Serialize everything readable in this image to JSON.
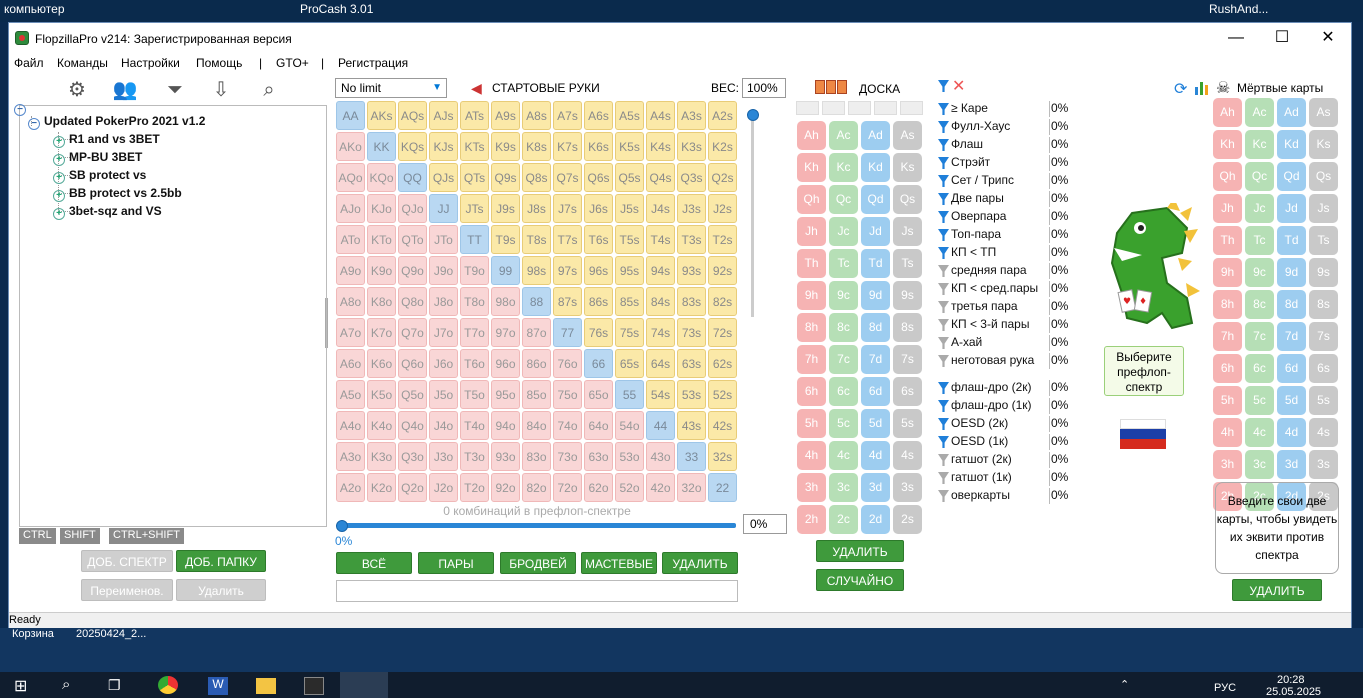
{
  "desktop": {
    "top_left": "компьютер",
    "top_mid": "ProCash 3.01",
    "top_right": "RushAnd...",
    "bottom_left": "Корзина",
    "bottom_mid": "20250424_2..."
  },
  "window": {
    "title": "FlopzillaPro v214: Зарегистрированная версия",
    "minimize": "—",
    "maximize": "☐",
    "close": "✕"
  },
  "menu": {
    "file": "Файл",
    "commands": "Команды",
    "settings": "Настройки",
    "help": "Помощь",
    "sep1": "|",
    "gto": "GTO+",
    "sep2": "|",
    "register": "Регистрация"
  },
  "tree": {
    "root": "Updated PokerPro 2021 v1.2",
    "items": [
      "R1 and vs 3BET",
      "MP-BU 3BET",
      "SB protect vs",
      "BB protect vs 2.5bb",
      "3bet-sqz and VS"
    ]
  },
  "keytabs": {
    "ctrl": "CTRL",
    "shift": "SHIFT",
    "ctrlshift": "CTRL+SHIFT"
  },
  "left_buttons": {
    "add_range": "ДОБ. СПЕКТР",
    "add_folder": "ДОБ. ПАПКУ",
    "rename": "Переименов.",
    "delete": "Удалить"
  },
  "matrix_top": {
    "limit_value": "No limit",
    "start_hands": "СТАРТОВЫЕ РУКИ",
    "weight_label": "ВЕС:",
    "weight_value": "100%"
  },
  "matrix": {
    "ranks": [
      "A",
      "K",
      "Q",
      "J",
      "T",
      "9",
      "8",
      "7",
      "6",
      "5",
      "4",
      "3",
      "2"
    ]
  },
  "combos": {
    "label": "0 комбинаций в префлоп-спектре",
    "pct_below": "0%",
    "pct_box": "0%"
  },
  "bottom_buttons": {
    "all": "ВСЁ",
    "pairs": "ПАРЫ",
    "broadway": "БРОДВЕЙ",
    "suited": "МАСТЕВЫЕ",
    "delete": "УДАЛИТЬ"
  },
  "board": {
    "label": "ДОСКА",
    "delete": "УДАЛИТЬ",
    "random": "СЛУЧАЙНО"
  },
  "filters": {
    "made": [
      {
        "name": "≥ Каре",
        "pct": "0%",
        "active": true
      },
      {
        "name": "Фулл-Хаус",
        "pct": "0%",
        "active": true
      },
      {
        "name": "Флаш",
        "pct": "0%",
        "active": true
      },
      {
        "name": "Стрэйт",
        "pct": "0%",
        "active": true
      },
      {
        "name": "Сет / Трипс",
        "pct": "0%",
        "active": true
      },
      {
        "name": "Две пары",
        "pct": "0%",
        "active": true
      },
      {
        "name": "Оверпара",
        "pct": "0%",
        "active": true
      },
      {
        "name": "Топ-пара",
        "pct": "0%",
        "active": true
      },
      {
        "name": "КП < ТП",
        "pct": "0%",
        "active": true
      },
      {
        "name": "средняя пара",
        "pct": "0%",
        "active": false
      },
      {
        "name": "КП < сред.пары",
        "pct": "0%",
        "active": false
      },
      {
        "name": "третья пара",
        "pct": "0%",
        "active": false
      },
      {
        "name": "КП < 3-й пары",
        "pct": "0%",
        "active": false
      },
      {
        "name": "А-хай",
        "pct": "0%",
        "active": false
      },
      {
        "name": "неготовая рука",
        "pct": "0%",
        "active": false
      }
    ],
    "draws": [
      {
        "name": "флаш-дро (2к)",
        "pct": "0%",
        "active": true
      },
      {
        "name": "флаш-дро (1к)",
        "pct": "0%",
        "active": true
      },
      {
        "name": "OESD (2к)",
        "pct": "0%",
        "active": true
      },
      {
        "name": "OESD (1к)",
        "pct": "0%",
        "active": true
      },
      {
        "name": "гатшот (2к)",
        "pct": "0%",
        "active": false
      },
      {
        "name": "гатшот (1к)",
        "pct": "0%",
        "active": false
      },
      {
        "name": "оверкарты",
        "pct": "0%",
        "active": false
      }
    ]
  },
  "dino": {
    "message": "Выберите префлоп-спектр"
  },
  "dead": {
    "label": "Мёртвые карты",
    "equity_text": "Введите свои две карты, чтобы увидеть их эквити против спектра",
    "delete": "УДАЛИТЬ"
  },
  "status": {
    "text": "Ready"
  },
  "taskbar": {
    "time": "20:28",
    "date": "25.05.2025",
    "lang": "РУС"
  },
  "colors": {
    "green_button": "#3f9a3c",
    "suited": "#fbe9a8",
    "offsuit": "#f9d6d6",
    "pair": "#b9d8f2",
    "hearts": "#f6b3b3",
    "clubs": "#b6dfb6",
    "diamonds": "#9dcdf0",
    "spades": "#c9c9c9"
  }
}
